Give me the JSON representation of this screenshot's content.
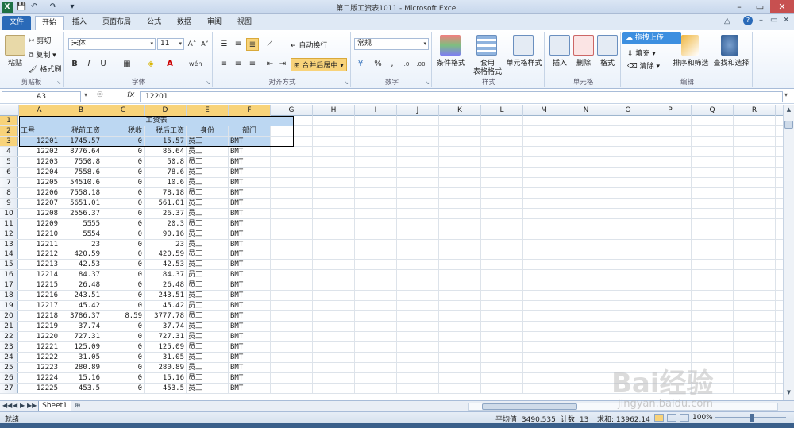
{
  "window": {
    "title": "第二版工资表1011 - Microsoft Excel",
    "minimize": "–",
    "restore": "▭",
    "close": "✕"
  },
  "quick_access": [
    "💾",
    "↶",
    "↷",
    "▾"
  ],
  "tabs": [
    {
      "label": "文件",
      "type": "file"
    },
    {
      "label": "开始",
      "active": true
    },
    {
      "label": "插入"
    },
    {
      "label": "页面布局"
    },
    {
      "label": "公式"
    },
    {
      "label": "数据"
    },
    {
      "label": "审阅"
    },
    {
      "label": "视图"
    }
  ],
  "ribbon": {
    "clipboard": {
      "label": "剪贴板",
      "paste": "粘贴",
      "cut": "剪切",
      "copy": "复制 ▾",
      "format_painter": "格式刷"
    },
    "font": {
      "label": "字体",
      "font_name": "宋体",
      "font_size": "11",
      "bold": "B",
      "italic": "I",
      "underline": "U",
      "grow": "A˄",
      "shrink": "A˅",
      "wen": "wén"
    },
    "alignment": {
      "label": "对齐方式",
      "wrap": "自动换行",
      "merge": "合并后居中"
    },
    "number": {
      "label": "数字",
      "format": "常规",
      "percent": "%",
      "comma": ",",
      "inc": ".0",
      "dec": ".00"
    },
    "styles": {
      "label": "样式",
      "conditional": "条件格式",
      "table": "套用",
      "table2": "表格格式",
      "cell": "单元格样式"
    },
    "cells": {
      "label": "单元格",
      "insert": "插入",
      "delete": "删除",
      "format": "格式"
    },
    "editing": {
      "label": "编辑",
      "upload": "拖拽上传",
      "fill": "填充",
      "clear": "清除",
      "sort": "排序和筛选",
      "find": "查找和选择"
    }
  },
  "formula_bar": {
    "name_box": "A3",
    "fx": "fx",
    "value": "12201"
  },
  "columns": [
    "A",
    "B",
    "C",
    "D",
    "E",
    "F",
    "G",
    "H",
    "I",
    "J",
    "K",
    "L",
    "M",
    "N",
    "O",
    "P",
    "Q",
    "R"
  ],
  "sheet": {
    "title": "工资表",
    "headers": [
      "工号",
      "税前工资",
      "税收",
      "税后工资",
      "身份",
      "部门"
    ],
    "rows": [
      [
        "12201",
        "1745.57",
        "0",
        "15.57",
        "员工",
        "BMT"
      ],
      [
        "12202",
        "8776.64",
        "0",
        "86.64",
        "员工",
        "BMT"
      ],
      [
        "12203",
        "7550.8",
        "0",
        "50.8",
        "员工",
        "BMT"
      ],
      [
        "12204",
        "7558.6",
        "0",
        "78.6",
        "员工",
        "BMT"
      ],
      [
        "12205",
        "54510.6",
        "0",
        "10.6",
        "员工",
        "BMT"
      ],
      [
        "12206",
        "7558.18",
        "0",
        "78.18",
        "员工",
        "BMT"
      ],
      [
        "12207",
        "5651.01",
        "0",
        "561.01",
        "员工",
        "BMT"
      ],
      [
        "12208",
        "2556.37",
        "0",
        "26.37",
        "员工",
        "BMT"
      ],
      [
        "12209",
        "5555",
        "0",
        "20.3",
        "员工",
        "BMT"
      ],
      [
        "12210",
        "5554",
        "0",
        "90.16",
        "员工",
        "BMT"
      ],
      [
        "12211",
        "23",
        "0",
        "23",
        "员工",
        "BMT"
      ],
      [
        "12212",
        "420.59",
        "0",
        "420.59",
        "员工",
        "BMT"
      ],
      [
        "12213",
        "42.53",
        "0",
        "42.53",
        "员工",
        "BMT"
      ],
      [
        "12214",
        "84.37",
        "0",
        "84.37",
        "员工",
        "BMT"
      ],
      [
        "12215",
        "26.48",
        "0",
        "26.48",
        "员工",
        "BMT"
      ],
      [
        "12216",
        "243.51",
        "0",
        "243.51",
        "员工",
        "BMT"
      ],
      [
        "12217",
        "45.42",
        "0",
        "45.42",
        "员工",
        "BMT"
      ],
      [
        "12218",
        "3786.37",
        "8.59",
        "3777.78",
        "员工",
        "BMT"
      ],
      [
        "12219",
        "37.74",
        "0",
        "37.74",
        "员工",
        "BMT"
      ],
      [
        "12220",
        "727.31",
        "0",
        "727.31",
        "员工",
        "BMT"
      ],
      [
        "12221",
        "125.09",
        "0",
        "125.09",
        "员工",
        "BMT"
      ],
      [
        "12222",
        "31.05",
        "0",
        "31.05",
        "员工",
        "BMT"
      ],
      [
        "12223",
        "280.89",
        "0",
        "280.89",
        "员工",
        "BMT"
      ],
      [
        "12224",
        "15.16",
        "0",
        "15.16",
        "员工",
        "BMT"
      ],
      [
        "12225",
        "453.5",
        "0",
        "453.5",
        "员工",
        "BMT"
      ]
    ]
  },
  "sheet_tabs": {
    "active": "Sheet1",
    "nav": [
      "◀◀",
      "◀",
      "▶",
      "▶▶"
    ]
  },
  "status": {
    "ready": "就绪",
    "average": "平均值: 3490.535",
    "count": "计数: 13",
    "sum": "求和: 13962.14",
    "zoom": "100%"
  },
  "watermark": {
    "text": "Bai经验",
    "sub": "jingyan.baidu.com"
  },
  "colors": {
    "accent": "#2a6ab8",
    "selection": "#bcd7f2",
    "header_highlight": "#f8d37a"
  }
}
